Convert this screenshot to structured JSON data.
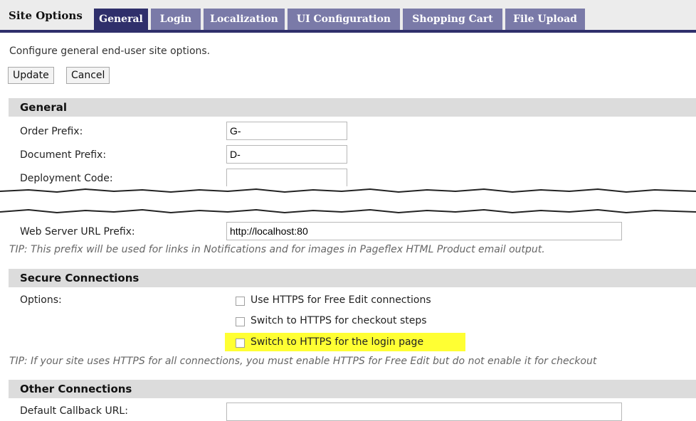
{
  "tabs": {
    "site_options": "Site Options",
    "items": [
      "General",
      "Login",
      "Localization",
      "UI Configuration",
      "Shopping Cart",
      "File Upload"
    ],
    "active": "General"
  },
  "intro": "Configure general end-user site options.",
  "buttons": {
    "update": "Update",
    "cancel": "Cancel"
  },
  "general": {
    "header": "General",
    "order_prefix_label": "Order Prefix:",
    "order_prefix_value": "G-",
    "document_prefix_label": "Document Prefix:",
    "document_prefix_value": "D-",
    "deployment_code_label": "Deployment Code:",
    "deployment_code_value": "",
    "web_server_label": "Web Server URL Prefix:",
    "web_server_value": "http://localhost:80",
    "tip": "TIP: This prefix will be used for links in Notifications and for images in Pageflex HTML Product email output."
  },
  "secure": {
    "header": "Secure Connections",
    "options_label": "Options:",
    "checkboxes": [
      {
        "label": "Use HTTPS for Free Edit connections",
        "checked": false
      },
      {
        "label": "Switch to HTTPS for checkout steps",
        "checked": false
      },
      {
        "label": "Switch to HTTPS for the login page",
        "checked": false
      }
    ],
    "tip": "TIP: If your site uses HTTPS for all connections, you must enable HTTPS for Free Edit but do not enable it for checkout"
  },
  "other": {
    "header": "Other Connections",
    "callback_label": "Default Callback URL:"
  },
  "colors": {
    "tab_active": "#2f2f6b",
    "tab": "#7a7aa8",
    "highlight": "#ffff33",
    "section": "#dcdcdc"
  }
}
